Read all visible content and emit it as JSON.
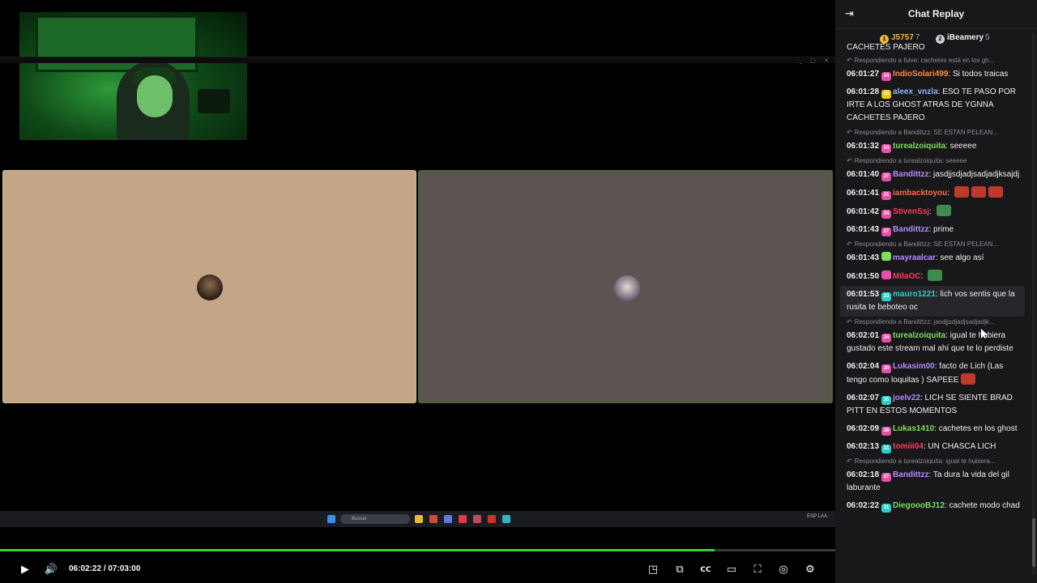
{
  "player": {
    "current_time": "06:02:22",
    "separator": "/",
    "duration": "07:03:00",
    "progress_percent": 85.5,
    "taskbar_search": "Buscar",
    "taskbar_tray": "ESP LAA"
  },
  "chat": {
    "title": "Chat Replay",
    "leaders": [
      {
        "rank": "1",
        "name": "J5757",
        "count": "7"
      },
      {
        "rank": "2",
        "name": "iBeamery",
        "count": "5"
      }
    ],
    "top_cut_text": "CACHETES PAJERO",
    "messages": [
      {
        "reply": "Respondiendo a fulve: cachetes está en los gh...",
        "time": "06:01:27",
        "badge": "24",
        "badge_color": "#e84fa8",
        "user": "IndioSolari499",
        "user_color": "#ff8a3d",
        "text": "Si todos traicas",
        "highlight": false,
        "emotes": []
      },
      {
        "reply": "",
        "time": "06:01:28",
        "badge": "15",
        "badge_color": "#f1c40f",
        "user": "aleex_vnzla",
        "user_color": "#8ab4ff",
        "text": "ESO TE PASO POR IRTE A LOS GHOST ATRAS DE YGNNA CACHETES PAJERO",
        "highlight": false,
        "emotes": []
      },
      {
        "reply": "Respondiendo a Bandittzz: SE ESTAN PELEAN...",
        "time": "06:01:32",
        "badge": "24",
        "badge_color": "#e84fa8",
        "user": "turealzoiquita",
        "user_color": "#7dde5b",
        "text": "seeeee",
        "highlight": false,
        "emotes": []
      },
      {
        "reply": "Respondiendo a turealzoiquita: seeeee",
        "time": "06:01:40",
        "badge": "27",
        "badge_color": "#e84fa8",
        "user": "Bandittzz",
        "user_color": "#b48cff",
        "text": "jasdjjsdjadjsadjadjksajdj",
        "highlight": false,
        "emotes": []
      },
      {
        "reply": "",
        "time": "06:01:41",
        "badge": "21",
        "badge_color": "#e84fa8",
        "user": "iambacktoyou",
        "user_color": "#ff6a3d",
        "text": "",
        "highlight": false,
        "emotes": [
          "#c0392b",
          "#c0392b",
          "#c0392b"
        ]
      },
      {
        "reply": "",
        "time": "06:01:42",
        "badge": "24",
        "badge_color": "#e84fa8",
        "user": "StivenSsj",
        "user_color": "#ff3b5c",
        "text": "",
        "highlight": false,
        "emotes": [
          "#3f8a4f"
        ]
      },
      {
        "reply": "",
        "time": "06:01:43",
        "badge": "27",
        "badge_color": "#e84fa8",
        "user": "Bandittzz",
        "user_color": "#b48cff",
        "text": "prime",
        "highlight": false,
        "emotes": []
      },
      {
        "reply": "Respondiendo a Bandittzz: SE ESTAN PELEAN...",
        "time": "06:01:43",
        "badge": "",
        "badge_color": "#7dde5b",
        "user": "mayraalcar",
        "user_color": "#b48cff",
        "text": "see algo así",
        "highlight": false,
        "emotes": []
      },
      {
        "reply": "",
        "time": "06:01:50",
        "badge": "",
        "badge_color": "#e84fa8",
        "user": "MilaOC",
        "user_color": "#ff3b5c",
        "text": "",
        "highlight": false,
        "emotes": [
          "#3f8a4f"
        ]
      },
      {
        "reply": "",
        "time": "06:01:53",
        "badge": "33",
        "badge_color": "#2ad1c9",
        "user": "mauro1221",
        "user_color": "#2ad1c9",
        "text": "lich vos sentis que la rusita te beboteo oc",
        "highlight": true,
        "emotes": []
      },
      {
        "reply": "Respondiendo a Bandittzz: jasdjjsdjadjsadjadjk...",
        "time": "06:02:01",
        "badge": "24",
        "badge_color": "#e84fa8",
        "user": "turealzoiquita",
        "user_color": "#7dde5b",
        "text": "igual te hubiera gustado este stream mal ahí que te lo perdiste",
        "highlight": false,
        "emotes": []
      },
      {
        "reply": "",
        "time": "06:02:04",
        "badge": "20",
        "badge_color": "#e84fa8",
        "user": "Lukasim00",
        "user_color": "#b48cff",
        "text": "facto de Lich (Las tengo como loquitas ) SAPEEE",
        "highlight": false,
        "emotes": [
          "#c0392b"
        ]
      },
      {
        "reply": "",
        "time": "06:02:07",
        "badge": "35",
        "badge_color": "#2ad1c9",
        "user": "joelv22",
        "user_color": "#b48cff",
        "text": "LICH SE SIENTE BRAD PITT EN ESTOS MOMENTOS",
        "highlight": false,
        "emotes": []
      },
      {
        "reply": "",
        "time": "06:02:09",
        "badge": "28",
        "badge_color": "#e84fa8",
        "user": "Lukas1410",
        "user_color": "#7dde5b",
        "text": "cachetes en los ghost",
        "highlight": false,
        "emotes": []
      },
      {
        "reply": "",
        "time": "06:02:13",
        "badge": "31",
        "badge_color": "#2ad1c9",
        "user": "tomiii04",
        "user_color": "#ff3b5c",
        "text": "UN CHASCA LICH",
        "highlight": false,
        "emotes": []
      },
      {
        "reply": "Respondiendo a turealzoiquita: igual te hubiera...",
        "time": "06:02:18",
        "badge": "27",
        "badge_color": "#e84fa8",
        "user": "Bandittzz",
        "user_color": "#b48cff",
        "text": "Ta dura la vida del gil laburante",
        "highlight": false,
        "emotes": []
      },
      {
        "reply": "",
        "time": "06:02:22",
        "badge": "31",
        "badge_color": "#2ad1c9",
        "user": "DiegoooBJ12",
        "user_color": "#7dde5b",
        "text": "cachete modo chad",
        "highlight": false,
        "emotes": []
      }
    ]
  },
  "colors": {
    "progress": "#3ec93e",
    "chat_bg": "#18181b",
    "tile_left": "#c2a686",
    "tile_right": "#5b5450"
  }
}
